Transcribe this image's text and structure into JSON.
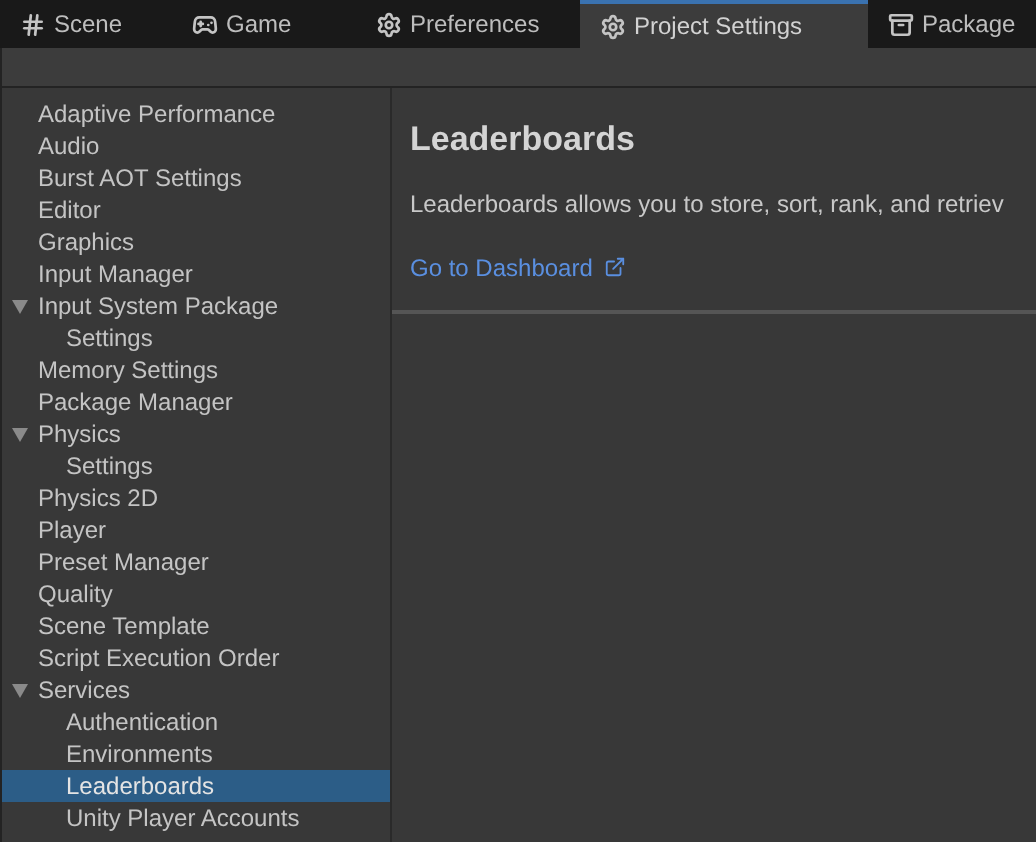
{
  "tabs": [
    {
      "label": "Scene",
      "selected": false
    },
    {
      "label": "Game",
      "selected": false
    },
    {
      "label": "Preferences",
      "selected": false
    },
    {
      "label": "Project Settings",
      "selected": true
    },
    {
      "label": "Package",
      "selected": false
    }
  ],
  "sidebar": {
    "items": [
      {
        "label": "Adaptive Performance",
        "selected": false
      },
      {
        "label": "Audio",
        "selected": false
      },
      {
        "label": "Burst AOT Settings",
        "selected": false
      },
      {
        "label": "Editor",
        "selected": false
      },
      {
        "label": "Graphics",
        "selected": false
      },
      {
        "label": "Input Manager",
        "selected": false
      },
      {
        "label": "Input System Package",
        "selected": false,
        "expanded": true,
        "children": [
          {
            "label": "Settings",
            "selected": false
          }
        ]
      },
      {
        "label": "Memory Settings",
        "selected": false
      },
      {
        "label": "Package Manager",
        "selected": false
      },
      {
        "label": "Physics",
        "selected": false,
        "expanded": true,
        "children": [
          {
            "label": "Settings",
            "selected": false
          }
        ]
      },
      {
        "label": "Physics 2D",
        "selected": false
      },
      {
        "label": "Player",
        "selected": false
      },
      {
        "label": "Preset Manager",
        "selected": false
      },
      {
        "label": "Quality",
        "selected": false
      },
      {
        "label": "Scene Template",
        "selected": false
      },
      {
        "label": "Script Execution Order",
        "selected": false
      },
      {
        "label": "Services",
        "selected": false,
        "expanded": true,
        "children": [
          {
            "label": "Authentication",
            "selected": false
          },
          {
            "label": "Environments",
            "selected": false
          },
          {
            "label": "Leaderboards",
            "selected": true
          },
          {
            "label": "Unity Player Accounts",
            "selected": false
          }
        ]
      }
    ]
  },
  "content": {
    "title": "Leaderboards",
    "description": "Leaderboards allows you to store, sort, rank, and retriev",
    "link": "Go to Dashboard"
  }
}
